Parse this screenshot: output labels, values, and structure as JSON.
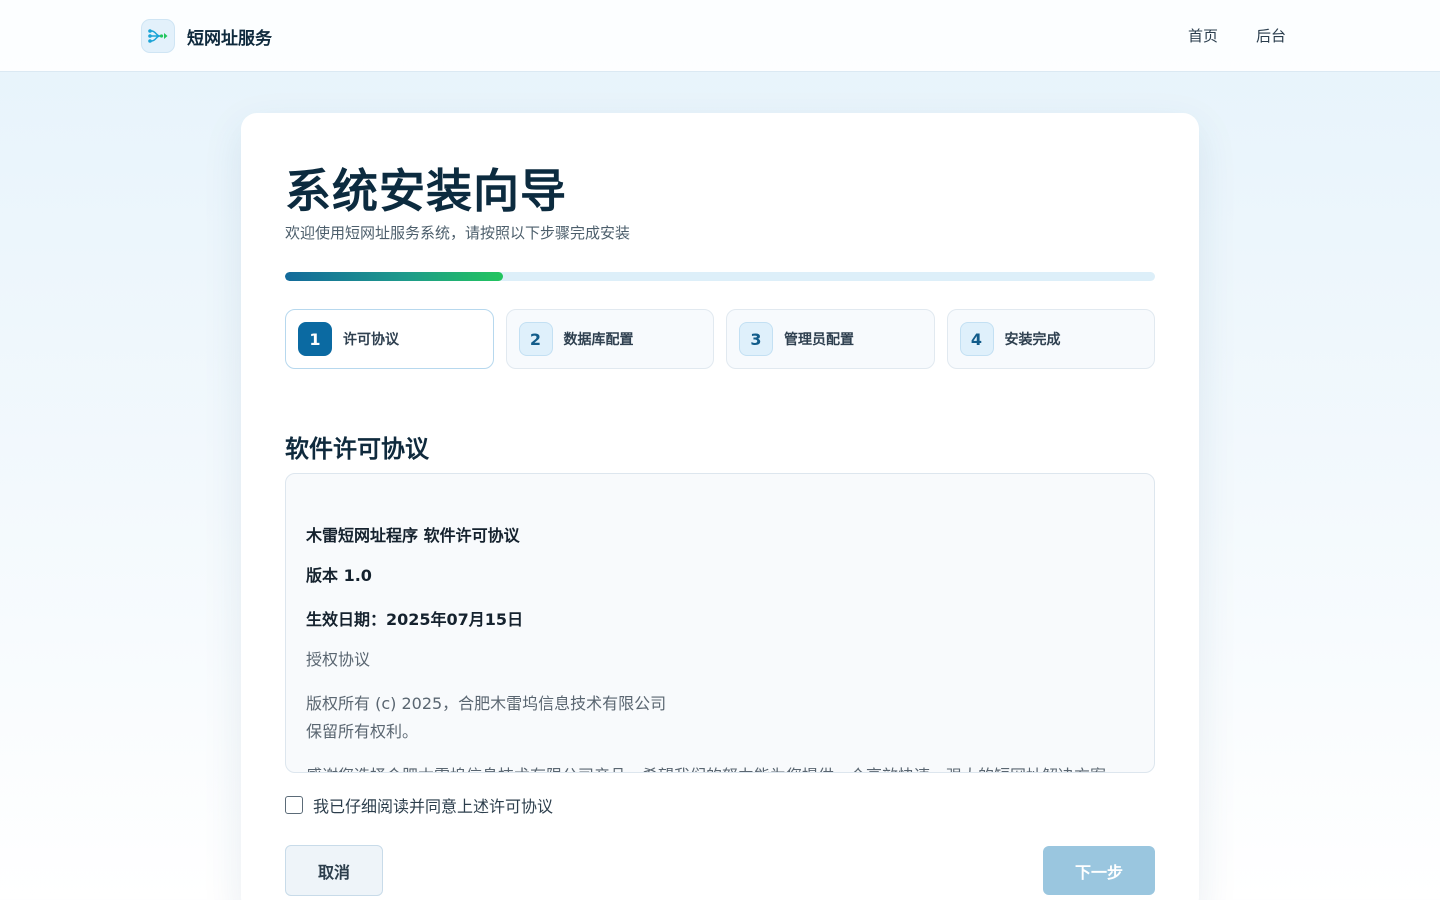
{
  "header": {
    "brand_name": "短网址服务",
    "nav": [
      {
        "label": "首页"
      },
      {
        "label": "后台"
      }
    ]
  },
  "wizard": {
    "title": "系统安装向导",
    "subtitle": "欢迎使用短网址服务系统，请按照以下步骤完成安装",
    "progress_fraction": 0.25,
    "steps": [
      {
        "number": "1",
        "label": "许可协议",
        "active": true
      },
      {
        "number": "2",
        "label": "数据库配置",
        "active": false
      },
      {
        "number": "3",
        "label": "管理员配置",
        "active": false
      },
      {
        "number": "4",
        "label": "安装完成",
        "active": false
      }
    ]
  },
  "license": {
    "section_title": "软件许可协议",
    "heading": "木雷短网址程序 软件许可协议",
    "version": "版本 1.0",
    "effective_date": "生效日期：2025年07月15日",
    "agreement_label": "授权协议",
    "copyright_line1": "版权所有 (c) 2025，合肥木雷坞信息技术有限公司",
    "copyright_line2": "保留所有权利。",
    "intro_partial": "感谢您选择合肥木雷坞信息技术有限公司产品。希望我们的努力能为您提供一个高效快速、强大的短网址解决方案。"
  },
  "agree": {
    "label": "我已仔细阅读并同意上述许可协议",
    "checked": false
  },
  "buttons": {
    "cancel": "取消",
    "next": "下一步"
  },
  "colors": {
    "primary": "#0b6aa2",
    "accent_green": "#22c55e",
    "next_disabled": "#9ac6df"
  }
}
